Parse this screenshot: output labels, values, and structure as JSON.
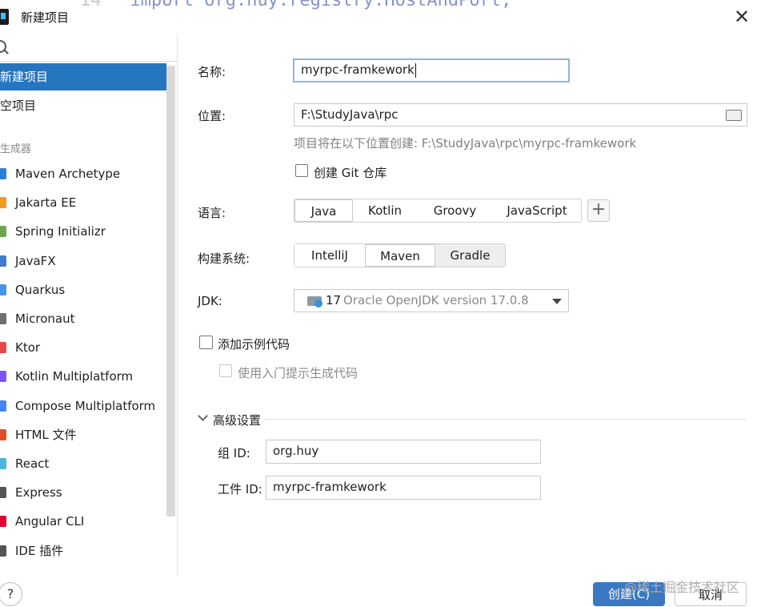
{
  "titlebar": {
    "title": "新建项目",
    "bg_line_number": "14",
    "bg_code": "import org.huy.registry.HostAndPort;"
  },
  "sidebar": {
    "items": [
      {
        "label": "新建项目",
        "selected": true
      },
      {
        "label": "空项目",
        "selected": false
      }
    ],
    "generators_header": "生成器",
    "generators": [
      {
        "label": "Maven Archetype",
        "icon": "maven-icon",
        "color": "#2d7fd6"
      },
      {
        "label": "Jakarta EE",
        "icon": "jakarta-icon",
        "color": "#f29b1d"
      },
      {
        "label": "Spring Initializr",
        "icon": "spring-icon",
        "color": "#6aa84f"
      },
      {
        "label": "JavaFX",
        "icon": "javafx-icon",
        "color": "#3f7bd0"
      },
      {
        "label": "Quarkus",
        "icon": "quarkus-icon",
        "color": "#4695eb"
      },
      {
        "label": "Micronaut",
        "icon": "micronaut-icon",
        "color": "#6f6f6f"
      },
      {
        "label": "Ktor",
        "icon": "ktor-icon",
        "color": "#e8474b"
      },
      {
        "label": "Kotlin Multiplatform",
        "icon": "kotlin-icon",
        "color": "#7f52ff"
      },
      {
        "label": "Compose Multiplatform",
        "icon": "compose-icon",
        "color": "#4285f4"
      },
      {
        "label": "HTML 文件",
        "icon": "html-icon",
        "color": "#e44d26"
      },
      {
        "label": "React",
        "icon": "react-icon",
        "color": "#4ab6d8"
      },
      {
        "label": "Express",
        "icon": "express-icon",
        "color": "#555555"
      },
      {
        "label": "Angular CLI",
        "icon": "angular-icon",
        "color": "#dd0031"
      },
      {
        "label": "IDE 插件",
        "icon": "plugin-icon",
        "color": "#555555"
      }
    ]
  },
  "form": {
    "name_label": "名称:",
    "name_value": "myrpc-framkework",
    "location_label": "位置:",
    "location_value": "F:\\StudyJava\\rpc",
    "location_hint": "项目将在以下位置创建: F:\\StudyJava\\rpc\\myrpc-framkework",
    "git_checkbox_label": "创建 Git 仓库",
    "language_label": "语言:",
    "languages": [
      "Java",
      "Kotlin",
      "Groovy",
      "JavaScript"
    ],
    "selected_language": "Java",
    "build_label": "构建系统:",
    "build_systems": [
      "IntelliJ",
      "Maven",
      "Gradle"
    ],
    "selected_build": "Maven",
    "jdk_label": "JDK:",
    "jdk_version": "17",
    "jdk_name": "Oracle OpenJDK version 17.0.8",
    "sample_code_label": "添加示例代码",
    "onboarding_label": "使用入门提示生成代码",
    "advanced_label": "高级设置",
    "group_id_label": "组 ID:",
    "group_id_value": "org.huy",
    "artifact_id_label": "工件 ID:",
    "artifact_id_value": "myrpc-framkework"
  },
  "footer": {
    "help_label": "?",
    "create_label": "创建(C)",
    "cancel_label": "取消",
    "watermark": "@稀土掘金技术社区"
  },
  "colors": {
    "accent": "#2675bf",
    "primary_button": "#3b78c3"
  }
}
